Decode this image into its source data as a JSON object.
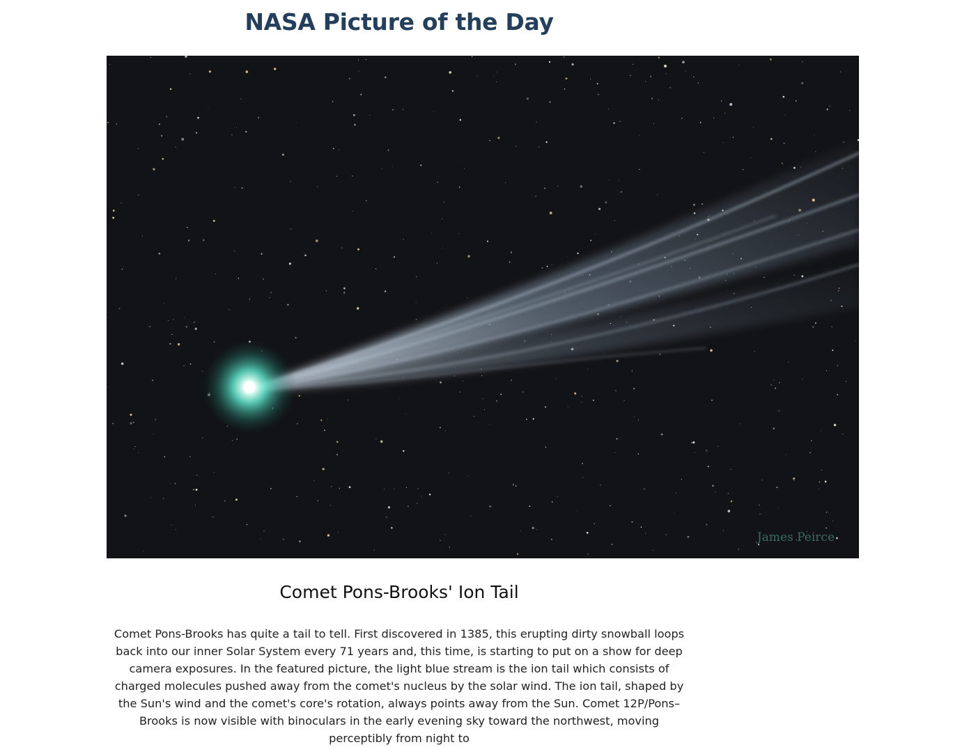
{
  "header": {
    "title": "NASA Picture of the Day"
  },
  "apod": {
    "image": {
      "alt": "Comet Pons-Brooks' Ion Tail",
      "credit_watermark": "James Peirce",
      "background_color": "#121316",
      "coma_color": "#5fe3c8",
      "tail_color": "#b8cde0"
    },
    "title": "Comet Pons-Brooks' Ion Tail",
    "explanation": "Comet Pons-Brooks has quite a tail to tell. First discovered in 1385, this erupting dirty snowball loops back into our inner Solar System every 71 years and, this time, is starting to put on a show for deep camera exposures. In the featured picture, the light blue stream is the ion tail which consists of charged molecules pushed away from the comet's nucleus by the solar wind. The ion tail, shaped by the Sun's wind and the comet's core's rotation, always points away from the Sun. Comet 12P/Pons–Brooks is now visible with binoculars in the early evening sky toward the northwest, moving perceptibly from night to"
  }
}
